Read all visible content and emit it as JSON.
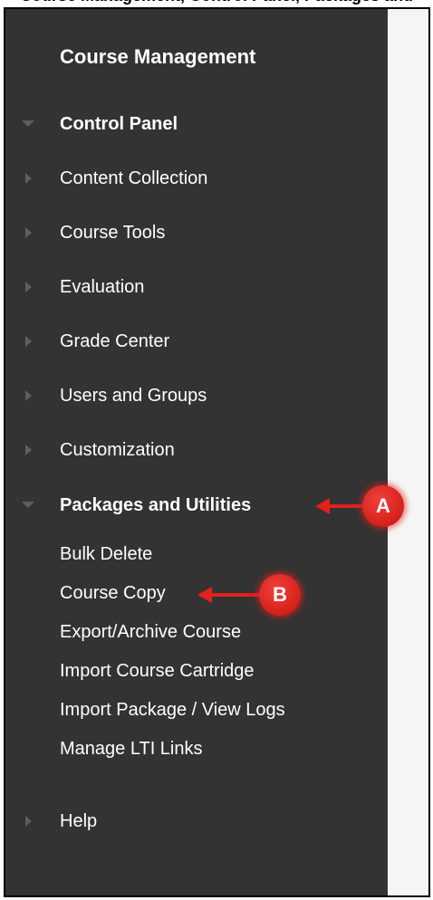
{
  "caption": "Course Management, Control Panel, Packages and Utilities...",
  "panel": {
    "title": "Course Management",
    "control_panel": "Control Panel",
    "items": [
      {
        "label": "Content Collection"
      },
      {
        "label": "Course Tools"
      },
      {
        "label": "Evaluation"
      },
      {
        "label": "Grade Center"
      },
      {
        "label": "Users and Groups"
      },
      {
        "label": "Customization"
      }
    ],
    "packages": {
      "label": "Packages and Utilities",
      "subitems": [
        {
          "label": "Bulk Delete"
        },
        {
          "label": "Course Copy"
        },
        {
          "label": "Export/Archive Course"
        },
        {
          "label": "Import Course Cartridge"
        },
        {
          "label": "Import Package / View Logs"
        },
        {
          "label": "Manage LTI Links"
        }
      ]
    },
    "help": "Help"
  },
  "callouts": {
    "a": "A",
    "b": "B",
    "color": "#e2201c"
  },
  "colors": {
    "panel_bg": "#333333",
    "content_bg": "#f5f5f5",
    "text": "#ffffff",
    "triangle": "#5e5e5e"
  }
}
